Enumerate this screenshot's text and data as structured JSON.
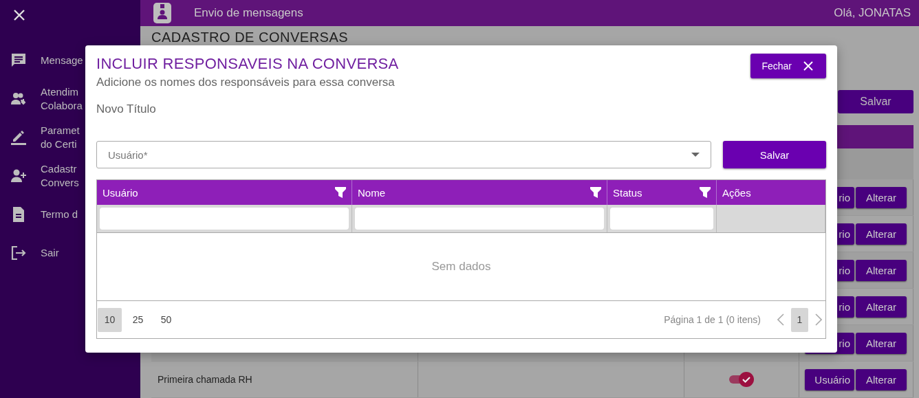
{
  "sidebar": {
    "items": [
      {
        "label": "Mensage"
      },
      {
        "label": "Atendim\nColabora"
      },
      {
        "label": "Paramet\ndo Certi"
      },
      {
        "label": "Cadastr\nConvers"
      },
      {
        "label": "Termo d"
      },
      {
        "label": "Sair"
      }
    ]
  },
  "topbar": {
    "title": "Envio de mensagens",
    "greeting": "Olá, JONATAS"
  },
  "page": {
    "title": "CADASTRO DE CONVERSAS",
    "save_button": "Salvar",
    "rows": [
      {
        "buttons": [
          "rio",
          "Alterar"
        ]
      },
      {
        "buttons": [
          "rio",
          "Alterar"
        ]
      },
      {
        "buttons": [
          "rio",
          "Alterar"
        ]
      },
      {
        "buttons": [
          "rio",
          "Alterar"
        ]
      },
      {
        "buttons": [
          "rio",
          "Alterar"
        ]
      },
      {
        "name": "Primeira chamada RH",
        "active": true,
        "buttons": [
          "Usuário",
          "Alterar"
        ]
      }
    ]
  },
  "modal": {
    "title": "INCLUIR RESPONSAVEIS NA CONVERSA",
    "subtitle": "Adicione os nomes dos responsáveis para essa conversa",
    "field_label": "Novo Título",
    "close_button": "Fechar",
    "user_select": {
      "placeholder": "Usuário*"
    },
    "save_button": "Salvar",
    "columns": [
      {
        "label": "Usuário",
        "filter": true
      },
      {
        "label": "Nome",
        "filter": true
      },
      {
        "label": "Status",
        "filter": true
      },
      {
        "label": "Ações",
        "filter": false
      }
    ],
    "empty_text": "Sem dados",
    "page_sizes": [
      {
        "label": "10",
        "selected": true
      },
      {
        "label": "25",
        "selected": false
      },
      {
        "label": "50",
        "selected": false
      }
    ],
    "page_info": "Página 1 de 1 (0 itens)",
    "pages": [
      {
        "label": "1",
        "selected": true
      }
    ]
  }
}
